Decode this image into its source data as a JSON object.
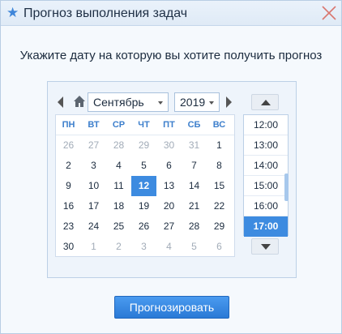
{
  "dialog": {
    "title": "Прогноз выполнения задач",
    "prompt": "Укажите дату на которую вы хотите получить прогноз"
  },
  "calendar": {
    "month": "Сентябрь",
    "year": "2019",
    "weekdays": [
      "ПН",
      "ВТ",
      "СР",
      "ЧТ",
      "ПТ",
      "СБ",
      "ВС"
    ],
    "weeks": [
      [
        "26",
        "27",
        "28",
        "29",
        "30",
        "31",
        "1"
      ],
      [
        "2",
        "3",
        "4",
        "5",
        "6",
        "7",
        "8"
      ],
      [
        "9",
        "10",
        "11",
        "12",
        "13",
        "14",
        "15"
      ],
      [
        "16",
        "17",
        "18",
        "19",
        "20",
        "21",
        "22"
      ],
      [
        "23",
        "24",
        "25",
        "26",
        "27",
        "28",
        "29"
      ],
      [
        "30",
        "1",
        "2",
        "3",
        "4",
        "5",
        "6"
      ]
    ],
    "selected_day": "12"
  },
  "time": {
    "items": [
      "12:00",
      "13:00",
      "14:00",
      "15:00",
      "16:00",
      "17:00"
    ],
    "selected": "17:00"
  },
  "actions": {
    "forecast_label": "Прогнозировать"
  },
  "colors": {
    "accent": "#3d8be0",
    "weekday": "#3d7fcc",
    "title_bg": "#e3edf8"
  }
}
